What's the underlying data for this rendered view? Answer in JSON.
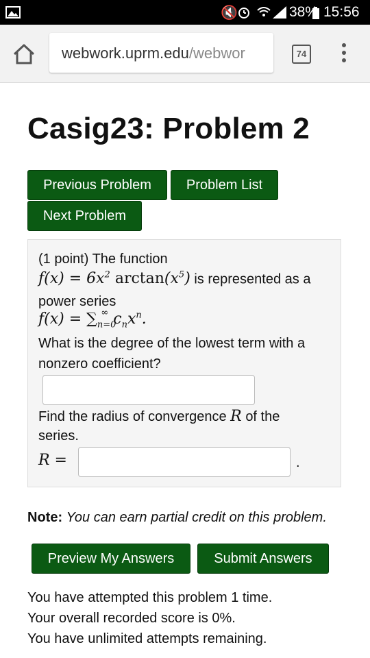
{
  "status_bar": {
    "battery": "38%",
    "time": "15:56"
  },
  "browser": {
    "url_host": "webwork.uprm.edu",
    "url_path": "/webwor",
    "tab_count": "74"
  },
  "page": {
    "title": "Casig23: Problem 2",
    "buttons": {
      "previous": "Previous Problem",
      "list": "Problem List",
      "next": "Next Problem"
    }
  },
  "problem": {
    "intro": "(1 point) The function",
    "function_lhs": "f(x) = 6x",
    "function_exp": "2",
    "function_arctan": "arctan",
    "function_arg": "(x",
    "function_arg_exp": "5",
    "function_close": ")",
    "function_tail": "is represented as a",
    "power_series_label": "power series",
    "series_lhs": "f(x) = ∑",
    "series_sub": "n=0",
    "series_sup": "∞",
    "series_term": "c",
    "series_term_sub": "n",
    "series_x": "x",
    "series_x_sup": "n",
    "series_end": ".",
    "question1_line1": "What is the degree of the lowest term with a",
    "question1_line2": "nonzero coefficient?",
    "answer1_value": "",
    "question2_prefix": "Find the radius of convergence",
    "question2_var": "R",
    "question2_suffix": "of the",
    "question2_line2": "series.",
    "r_label": "R =",
    "answer2_value": "",
    "trailing_period": "."
  },
  "note": {
    "label": "Note:",
    "text": "You can earn partial credit on this problem."
  },
  "actions": {
    "preview": "Preview My Answers",
    "submit": "Submit Answers"
  },
  "status": {
    "attempts": "You have attempted this problem 1 time.",
    "score": "Your overall recorded score is 0%.",
    "remaining": "You have unlimited attempts remaining."
  }
}
